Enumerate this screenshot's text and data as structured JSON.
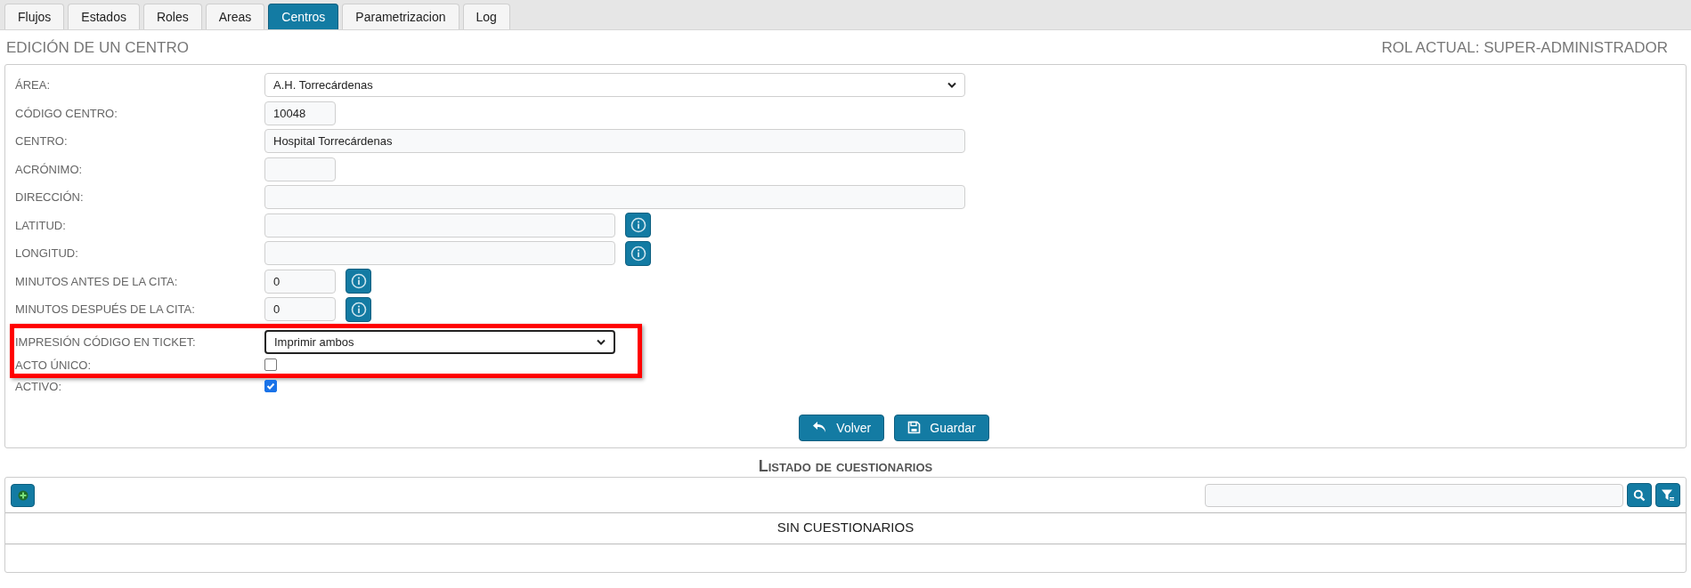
{
  "tabs": [
    {
      "label": "Flujos",
      "selected": false
    },
    {
      "label": "Estados",
      "selected": false
    },
    {
      "label": "Roles",
      "selected": false
    },
    {
      "label": "Areas",
      "selected": false
    },
    {
      "label": "Centros",
      "selected": true
    },
    {
      "label": "Parametrizacion",
      "selected": false
    },
    {
      "label": "Log",
      "selected": false
    }
  ],
  "header": {
    "title": "EDICIÓN DE UN CENTRO",
    "role": "ROL ACTUAL: SUPER-ADMINISTRADOR"
  },
  "form": {
    "fields": [
      {
        "label": "ÁREA:",
        "kind": "longselect",
        "value": "A.H. Torrecárdenas",
        "info_button": false,
        "focused": false,
        "highlighted": false
      },
      {
        "label": "CÓDIGO CENTRO:",
        "kind": "shorttext",
        "value": "10048",
        "info_button": false,
        "focused": false,
        "highlighted": false
      },
      {
        "label": "CENTRO:",
        "kind": "longtext",
        "value": "Hospital Torrecárdenas",
        "info_button": false,
        "focused": false,
        "highlighted": false
      },
      {
        "label": "ACRÓNIMO:",
        "kind": "shorttext",
        "info_button": false,
        "focused": false,
        "highlighted": false
      },
      {
        "label": "DIRECCIÓN:",
        "kind": "longtext",
        "info_button": false,
        "focused": false,
        "highlighted": false
      },
      {
        "label": "LATITUD:",
        "kind": "text",
        "info_button": true,
        "focused": false,
        "highlighted": false
      },
      {
        "label": "LONGITUD:",
        "kind": "text",
        "info_button": true,
        "focused": false,
        "highlighted": false
      },
      {
        "label": "MINUTOS ANTES DE LA CITA:",
        "kind": "shorttext",
        "value": "0",
        "info_button": true,
        "focused": false,
        "highlighted": false
      },
      {
        "label": "MINUTOS DESPUÉS DE LA CITA:",
        "kind": "shorttext",
        "value": "0",
        "info_button": true,
        "focused": false,
        "highlighted": false
      },
      {
        "label": "IMPRESIÓN CÓDIGO EN TICKET:",
        "kind": "select",
        "value": "Imprimir ambos",
        "info_button": false,
        "focused": true,
        "highlighted": true
      },
      {
        "label": "ACTO ÚNICO:",
        "kind": "checkbox",
        "checked": false,
        "highlighted": true
      },
      {
        "label": "ACTIVO:",
        "kind": "checkbox",
        "checked": true,
        "highlighted": false
      }
    ],
    "buttons": [
      {
        "label": "Volver",
        "kind": "back"
      },
      {
        "label": "Guardar",
        "kind": "save"
      }
    ]
  },
  "listing": {
    "title": "Listado de cuestionarios",
    "empty_message": "SIN CUESTIONARIOS"
  }
}
